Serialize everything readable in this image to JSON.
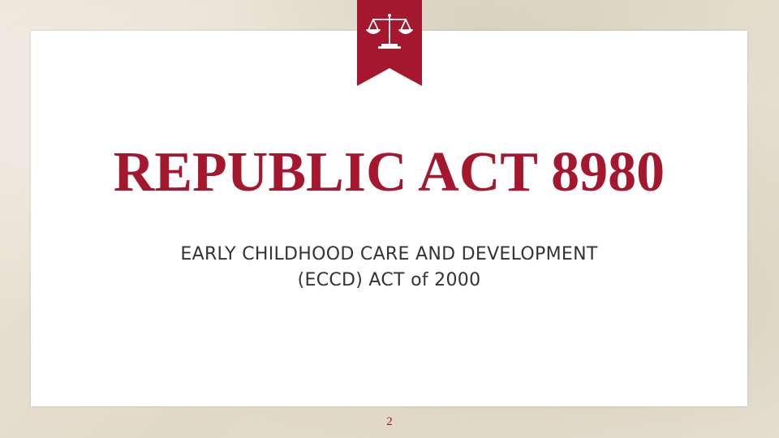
{
  "slide": {
    "title": "REPUBLIC ACT 8980",
    "subtitle_line1": "EARLY CHILDHOOD CARE AND DEVELOPMENT",
    "subtitle_line2": "(ECCD) ACT of 2000",
    "page_number": "2"
  },
  "ribbon": {
    "icon": "scales-of-justice-icon",
    "color": "#a5162f"
  },
  "colors": {
    "accent": "#a5162f",
    "text": "#333333",
    "background": "#e7e0d2",
    "panel": "#ffffff"
  }
}
